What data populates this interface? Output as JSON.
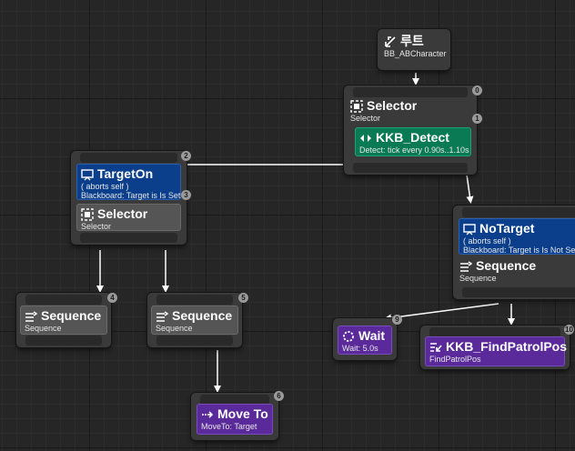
{
  "root": {
    "title": "루트",
    "subtitle": "BB_ABCharacter"
  },
  "selector_main": {
    "title": "Selector",
    "subtitle": "Selector",
    "badge": "0",
    "badge2": "1"
  },
  "service_detect": {
    "title": "KKB_Detect",
    "subtitle": "Detect: tick every 0.90s..1.10s"
  },
  "target_on": {
    "title": "TargetOn",
    "line1": "( aborts self )",
    "line2": "Blackboard: Target is Is Set",
    "badge": "2",
    "badge2": "3"
  },
  "selector_sub": {
    "title": "Selector",
    "subtitle": "Selector"
  },
  "no_target": {
    "title": "NoTarget",
    "line1": "( aborts self )",
    "line2": "Blackboard: Target is Is Not Set"
  },
  "sequence_no_target": {
    "title": "Sequence",
    "subtitle": "Sequence"
  },
  "sequence_4": {
    "title": "Sequence",
    "subtitle": "Sequence",
    "badge": "4"
  },
  "sequence_5": {
    "title": "Sequence",
    "subtitle": "Sequence",
    "badge": "5"
  },
  "move_to": {
    "title": "Move To",
    "subtitle": "MoveTo: Target",
    "badge": "6"
  },
  "wait": {
    "title": "Wait",
    "subtitle": "Wait: 5.0s",
    "badge": "9"
  },
  "find_patrol": {
    "title": "KKB_FindPatrolPos",
    "subtitle": "FindPatrolPos",
    "badge": "10"
  },
  "colors": {
    "decorator": "#0b3f8c",
    "service": "#0a7a55",
    "task": "#5a2a9a",
    "composite": "#555555"
  }
}
